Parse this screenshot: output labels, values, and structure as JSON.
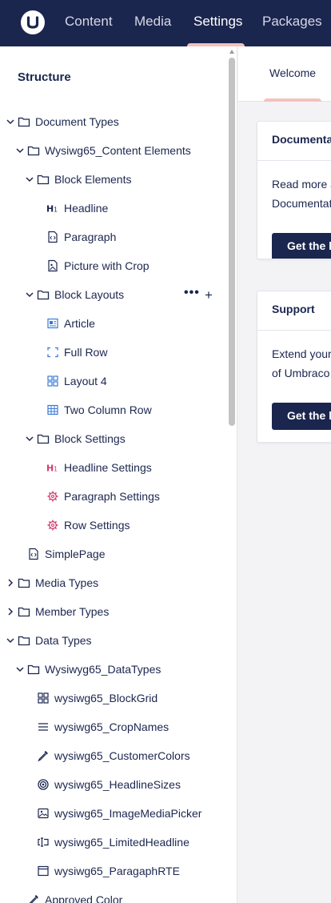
{
  "header": {
    "logo_icon": "umbraco-logo",
    "nav": [
      {
        "label": "Content",
        "active": false
      },
      {
        "label": "Media",
        "active": false
      },
      {
        "label": "Settings",
        "active": true
      },
      {
        "label": "Packages",
        "active": false
      }
    ]
  },
  "sidebar": {
    "title": "Structure",
    "tree": [
      {
        "label": "Document Types",
        "icon": "folder-icon",
        "expanded": true
      },
      {
        "label": "Wysiwg65_Content Elements",
        "icon": "folder-icon",
        "expanded": true
      },
      {
        "label": "Block Elements",
        "icon": "folder-icon",
        "expanded": true
      },
      {
        "label": "Headline",
        "icon": "heading-icon"
      },
      {
        "label": "Paragraph",
        "icon": "code-document-icon"
      },
      {
        "label": "Picture with Crop",
        "icon": "picture-document-icon"
      },
      {
        "label": "Block Layouts",
        "icon": "folder-icon",
        "expanded": true,
        "actions": {
          "more": "•••",
          "add": "+"
        }
      },
      {
        "label": "Article",
        "icon": "article-icon"
      },
      {
        "label": "Full Row",
        "icon": "full-row-icon"
      },
      {
        "label": "Layout 4",
        "icon": "layout-grid-icon"
      },
      {
        "label": "Two Column Row",
        "icon": "table-icon"
      },
      {
        "label": "Block Settings",
        "icon": "folder-icon",
        "expanded": true
      },
      {
        "label": "Headline Settings",
        "icon": "heading-icon"
      },
      {
        "label": "Paragraph Settings",
        "icon": "gear-icon"
      },
      {
        "label": "Row Settings",
        "icon": "gear-icon"
      },
      {
        "label": "SimplePage",
        "icon": "code-document-icon"
      },
      {
        "label": "Media Types",
        "icon": "folder-icon",
        "expanded": false
      },
      {
        "label": "Member Types",
        "icon": "folder-icon",
        "expanded": false
      },
      {
        "label": "Data Types",
        "icon": "folder-icon",
        "expanded": true
      },
      {
        "label": "Wysiwyg65_DataTypes",
        "icon": "folder-icon",
        "expanded": true
      },
      {
        "label": "wysiwg65_BlockGrid",
        "icon": "block-grid-icon"
      },
      {
        "label": "wysiwg65_CropNames",
        "icon": "list-icon"
      },
      {
        "label": "wysiwg65_CustomerColors",
        "icon": "color-picker-icon"
      },
      {
        "label": "wysiwg65_HeadlineSizes",
        "icon": "target-icon"
      },
      {
        "label": "wysiwg65_ImageMediaPicker",
        "icon": "image-icon"
      },
      {
        "label": "wysiwg65_LimitedHeadline",
        "icon": "text-box-icon"
      },
      {
        "label": "wysiwg65_ParagaphRTE",
        "icon": "window-icon"
      },
      {
        "label": "Approved Color",
        "icon": "color-picker-icon"
      }
    ]
  },
  "main": {
    "tabs": [
      {
        "label": "Welcome",
        "active": true
      }
    ],
    "cards": [
      {
        "title": "Documentation",
        "text_lines": [
          "Read more about",
          "Documentation"
        ],
        "button": "Get the help"
      },
      {
        "title": "Support",
        "text_lines": [
          "Extend your Umbraco",
          "of Umbraco"
        ],
        "button": "Get the help"
      }
    ]
  },
  "colors": {
    "header_bg": "#1b264f",
    "nav_active_indicator": "#f5c1bc",
    "text_primary": "#1b264f",
    "icon_blue": "#3a7ad6",
    "icon_pink": "#d33b6d",
    "button_bg": "#1b264f"
  }
}
